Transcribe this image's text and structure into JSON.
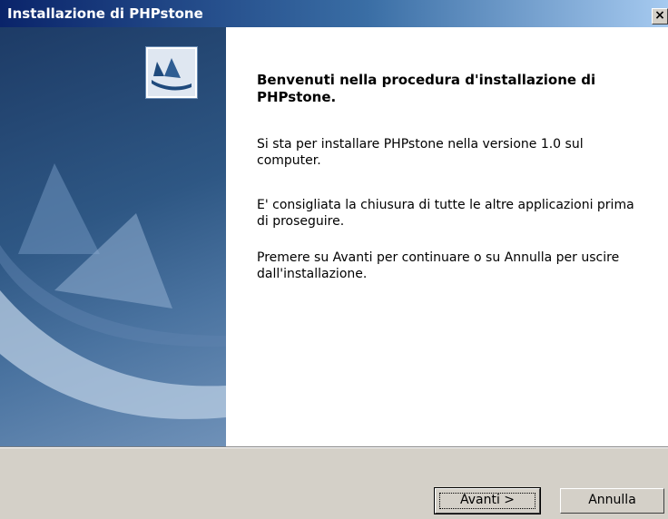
{
  "window": {
    "title": "Installazione di PHPstone",
    "close_label": "×"
  },
  "sidebar": {
    "logo_icon": "installer-logo-icon",
    "artwork": "sails-artwork"
  },
  "content": {
    "heading": "Benvenuti nella procedura d'installazione di PHPstone.",
    "paragraph1": "Si sta per installare PHPstone nella versione 1.0 sul computer.",
    "paragraph2": "E' consigliata la chiusura di tutte le altre applicazioni prima di proseguire.",
    "paragraph3": "Premere su Avanti per continuare o su Annulla per uscire dall'installazione."
  },
  "buttons": {
    "next_label": "Avanti >",
    "cancel_label": "Annulla"
  },
  "colors": {
    "titlebar_start": "#0a246a",
    "titlebar_end": "#a6caf0",
    "panel_blue": "#2e5784",
    "dialog_gray": "#d4d0c8"
  }
}
